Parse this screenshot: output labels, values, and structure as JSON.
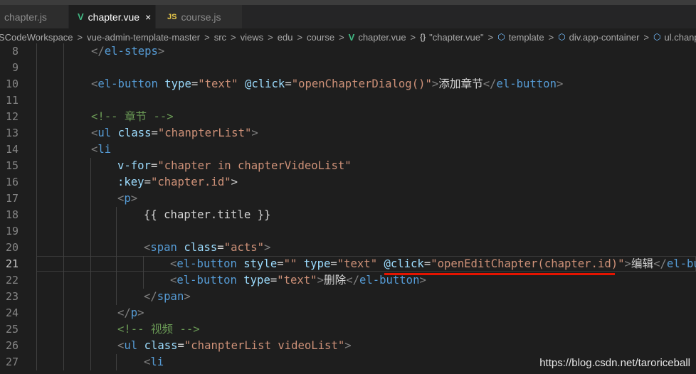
{
  "tabs": [
    {
      "label": "chapter.js",
      "icon": "js-icon",
      "active": false
    },
    {
      "label": "chapter.vue",
      "icon": "vue-icon",
      "active": true
    },
    {
      "label": "course.js",
      "icon": "js-icon",
      "active": false
    }
  ],
  "tab_icons": {
    "vue": "V",
    "js": "JS",
    "close": "×"
  },
  "breadcrumb": {
    "items": [
      "SCodeWorkspace",
      "vue-admin-template-master",
      "src",
      "views",
      "edu",
      "course",
      "chapter.vue",
      "\"chapter.vue\"",
      "template",
      "div.app-container",
      "ul.chanp"
    ],
    "separator": ">",
    "braces": "{}",
    "cube": "⬡"
  },
  "editor": {
    "current_line": 21,
    "lines": [
      {
        "n": "8",
        "text": "</el-steps>"
      },
      {
        "n": "9",
        "text": ""
      },
      {
        "n": "10",
        "text": "<el-button type=\"text\" @click=\"openChapterDialog()\">添加章节</el-button>"
      },
      {
        "n": "11",
        "text": ""
      },
      {
        "n": "12",
        "text": "<!-- 章节 -->"
      },
      {
        "n": "13",
        "text": "<ul class=\"chanpterList\">"
      },
      {
        "n": "14",
        "text": "<li"
      },
      {
        "n": "15",
        "text": "v-for=\"chapter in chapterVideoList\""
      },
      {
        "n": "16",
        "text": ":key=\"chapter.id\">"
      },
      {
        "n": "17",
        "text": "<p>"
      },
      {
        "n": "18",
        "text": "{{ chapter.title }}"
      },
      {
        "n": "19",
        "text": ""
      },
      {
        "n": "20",
        "text": "<span class=\"acts\">"
      },
      {
        "n": "21",
        "text": "<el-button style=\"\" type=\"text\" @click=\"openEditChapter(chapter.id)\">编辑</el-bu"
      },
      {
        "n": "22",
        "text": "<el-button type=\"text\">删除</el-button>"
      },
      {
        "n": "23",
        "text": "</span>"
      },
      {
        "n": "24",
        "text": "</p>"
      },
      {
        "n": "25",
        "text": "<!-- 视频 -->"
      },
      {
        "n": "26",
        "text": "<ul class=\"chanpterList videoList\">"
      },
      {
        "n": "27",
        "text": "<li"
      }
    ]
  },
  "annotation": {
    "underline_color": "#e51400"
  },
  "watermark": "https://blog.csdn.net/taroriceball",
  "colors": {
    "background": "#1e1e1e",
    "tag": "#569cd6",
    "attribute": "#9cdcfe",
    "string": "#ce9178",
    "comment": "#6a9955",
    "line_number": "#858585"
  }
}
